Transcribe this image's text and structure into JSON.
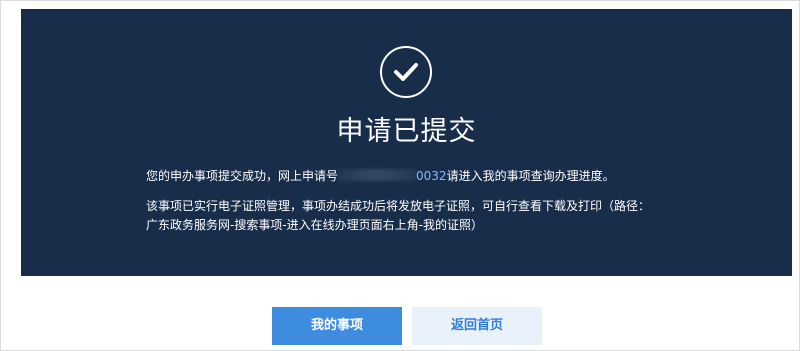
{
  "status": {
    "title": "申请已提交",
    "icon": "check-circle-icon"
  },
  "message": {
    "line1_prefix": "您的申办事项提交成功，网上申请号",
    "application_number_suffix": "0032",
    "line1_suffix": "请进入我的事项查询办理进度。",
    "line2": "该事项已实行电子证照管理，事项办结成功后将发放电子证照，可自行查看下载及打印（路径：",
    "line3": "广东政务服务网-搜索事项-进入在线办理页面右上角-我的证照）"
  },
  "actions": {
    "my_items_label": "我的事项",
    "back_home_label": "返回首页"
  },
  "colors": {
    "panel_bg": "#172d4a",
    "primary_button": "#3d8ce0",
    "secondary_button": "#e9f1fb",
    "link_text": "#8fb6ff"
  }
}
